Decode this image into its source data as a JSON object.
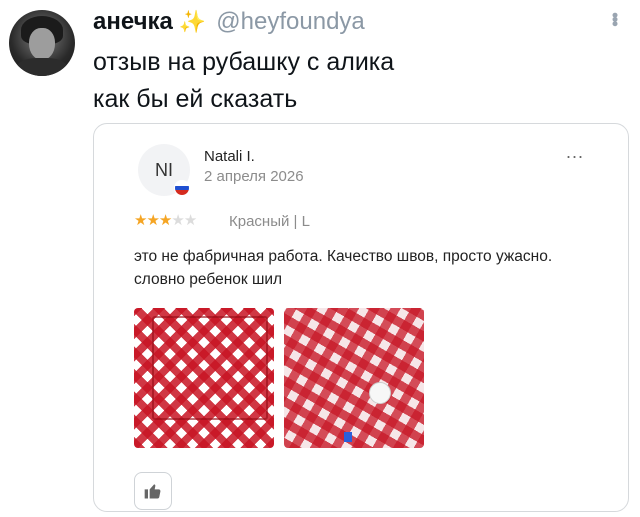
{
  "tweet": {
    "display_name": "анечка",
    "emoji": "✨",
    "handle": "@heyfoundya",
    "lines": [
      "отзыв на рубашку с алика",
      "как бы ей сказать"
    ]
  },
  "review": {
    "initials": "NI",
    "reviewer_name": "Natali I.",
    "date": "2 апреля 2026",
    "menu": "...",
    "rating": 3,
    "rating_max": 5,
    "variant": "Красный | L",
    "text": "это не фабричная работа. Качество швов, просто ужасно. словно ребенок шил",
    "photos": [
      "photo-1",
      "photo-2"
    ],
    "colors": {
      "star_filled": "#f5a524",
      "star_empty": "#dcdcdc",
      "flag": [
        "#ffffff",
        "#1f4fd1",
        "#d52b1e"
      ]
    }
  },
  "icons": [
    "more-vertical-icon",
    "sparkles-icon",
    "thumbs-up-icon",
    "star-icon",
    "flag-icon"
  ]
}
